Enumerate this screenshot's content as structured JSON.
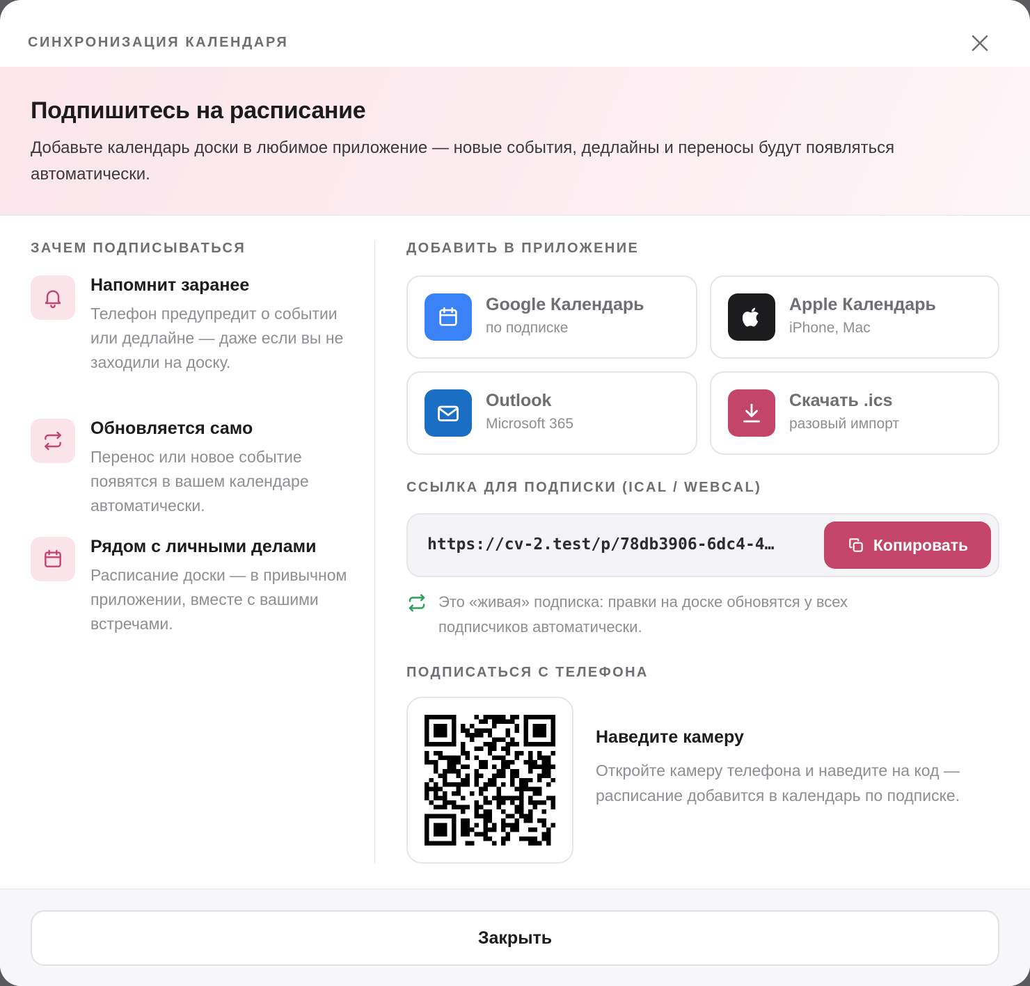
{
  "header": {
    "eyebrow": "СИНХРОНИЗАЦИЯ КАЛЕНДАРЯ",
    "close_icon": "close-icon"
  },
  "hero": {
    "title": "Подпишитесь на расписание",
    "subtitle": "Добавьте календарь доски в любимое приложение — новые события, дедлайны и переносы будут появляться автоматически."
  },
  "why": {
    "label": "ЗАЧЕМ ПОДПИСЫВАТЬСЯ",
    "items": [
      {
        "icon": "bell-icon",
        "title": "Напомнит заранее",
        "text": "Телефон предупредит о событии или дедлайне — даже если вы не заходили на доску."
      },
      {
        "icon": "refresh-icon",
        "title": "Обновляется само",
        "text": "Перенос или новое событие появятся в вашем календаре автоматически."
      },
      {
        "icon": "calendar-icon",
        "title": "Рядом с личными делами",
        "text": "Расписание доски — в привычном приложении, вместе с вашими встречами."
      }
    ]
  },
  "apps": {
    "label": "ДОБАВИТЬ В ПРИЛОЖЕНИЕ",
    "items": [
      {
        "icon": "calendar-icon",
        "name": "Google Календарь",
        "sub": "по подписке",
        "color": "#3b82f6"
      },
      {
        "icon": "apple-icon",
        "name": "Apple Календарь",
        "sub": "iPhone, Mac",
        "color": "#1c1c1e"
      },
      {
        "icon": "mail-icon",
        "name": "Outlook",
        "sub": "Microsoft 365",
        "color": "#1a6fc4"
      },
      {
        "icon": "download-icon",
        "name": "Скачать .ics",
        "sub": "разовый импорт",
        "color": "#c4456a"
      }
    ]
  },
  "link": {
    "label": "ССЫЛКА ДЛЯ ПОДПИСКИ (ICAL / WEBCAL)",
    "url": "https://cv-2.test/p/78db3906-6dc4-4…",
    "copy_label": "Копировать",
    "note": "Это «живая» подписка: правки на доске обновятся у всех подписчиков автоматически."
  },
  "phone": {
    "label": "ПОДПИСАТЬСЯ С ТЕЛЕФОНА",
    "title": "Наведите камеру",
    "text": "Откройте камеру телефона и наведите на код — расписание добавится в календарь по подписке."
  },
  "footer": {
    "close_label": "Закрыть"
  },
  "colors": {
    "accent": "#c4456a",
    "accent_soft": "#fbe4ea",
    "note_icon": "#2e9e5b"
  }
}
